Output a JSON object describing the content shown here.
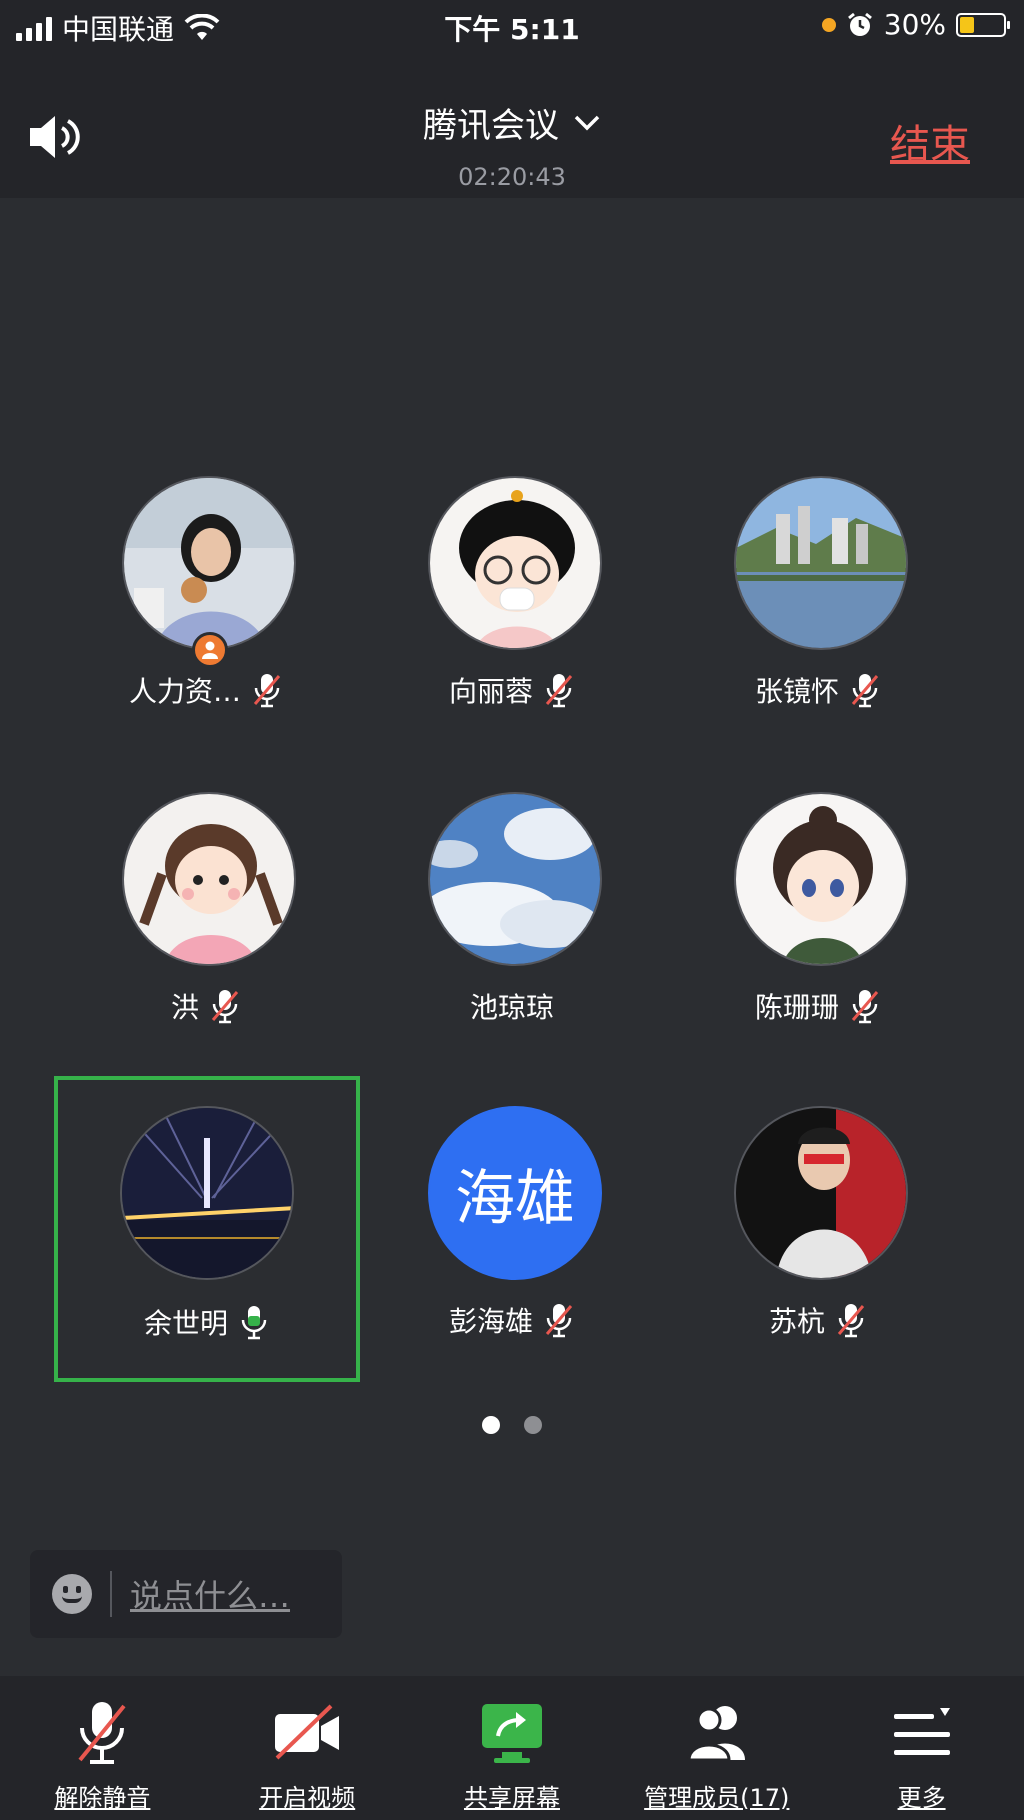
{
  "status_bar": {
    "carrier": "中国联通",
    "time": "下午 5:11",
    "battery": "30%"
  },
  "header": {
    "title": "腾讯会议",
    "duration": "02:20:43",
    "end_label": "结束"
  },
  "participants": [
    {
      "name": "人力资…",
      "mic": "muted",
      "host": true,
      "avatar": "photo"
    },
    {
      "name": "向丽蓉",
      "mic": "muted",
      "avatar": "cartoon"
    },
    {
      "name": "张镜怀",
      "mic": "muted",
      "avatar": "landscape"
    },
    {
      "name": "洪",
      "mic": "muted",
      "avatar": "cartoon-girl"
    },
    {
      "name": "池琼琼",
      "mic": "none",
      "avatar": "sky"
    },
    {
      "name": "陈珊珊",
      "mic": "muted",
      "avatar": "cartoon-girl2"
    },
    {
      "name": "余世明",
      "mic": "active",
      "speaking": true,
      "avatar": "bridge-night"
    },
    {
      "name": "彭海雄",
      "mic": "muted",
      "avatar_text": "海雄"
    },
    {
      "name": "苏杭",
      "mic": "muted",
      "avatar": "photo-red"
    }
  ],
  "pager": {
    "pages": 2,
    "current": 1
  },
  "chat": {
    "placeholder": "说点什么…"
  },
  "toolbar": {
    "unmute": "解除静音",
    "video": "开启视频",
    "share": "共享屏幕",
    "members": "管理成员(17)",
    "more": "更多"
  },
  "colors": {
    "background": "#2b2d31",
    "bar": "#242529",
    "end": "#e8574f",
    "speaking": "#36b24a",
    "share": "#3bb54a",
    "avatar_text_bg": "#2e6ff2"
  }
}
